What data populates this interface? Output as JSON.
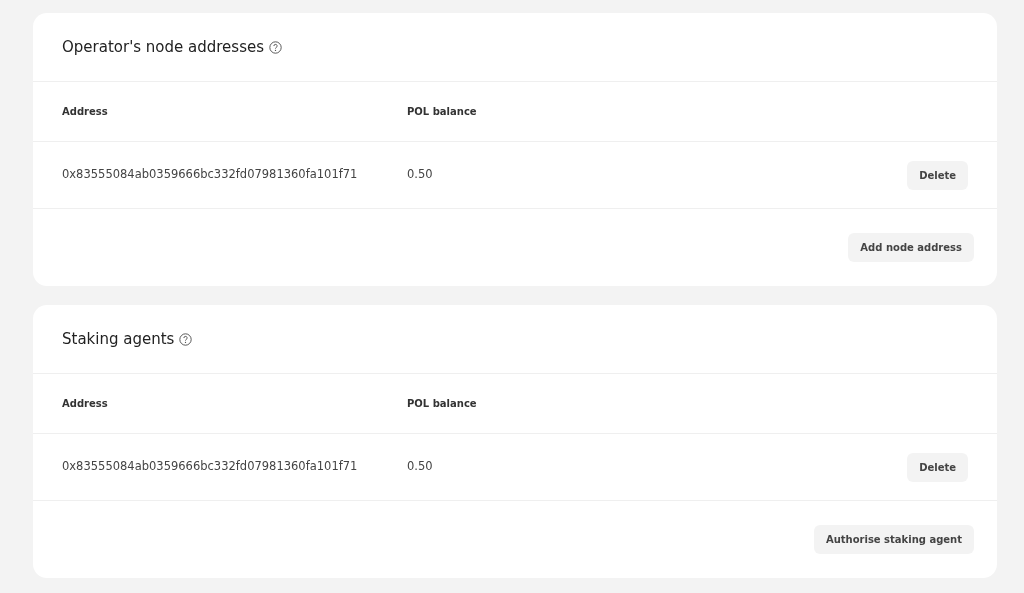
{
  "sections": [
    {
      "title": "Operator's node addresses",
      "columns": [
        "Address",
        "POL balance"
      ],
      "rows": [
        {
          "address": "0x83555084ab0359666bc332fd07981360fa101f71",
          "balance": "0.50",
          "action": "Delete"
        }
      ],
      "footer_button": "Add node address"
    },
    {
      "title": "Staking agents",
      "columns": [
        "Address",
        "POL balance"
      ],
      "rows": [
        {
          "address": "0x83555084ab0359666bc332fd07981360fa101f71",
          "balance": "0.50",
          "action": "Delete"
        }
      ],
      "footer_button": "Authorise staking agent"
    }
  ]
}
